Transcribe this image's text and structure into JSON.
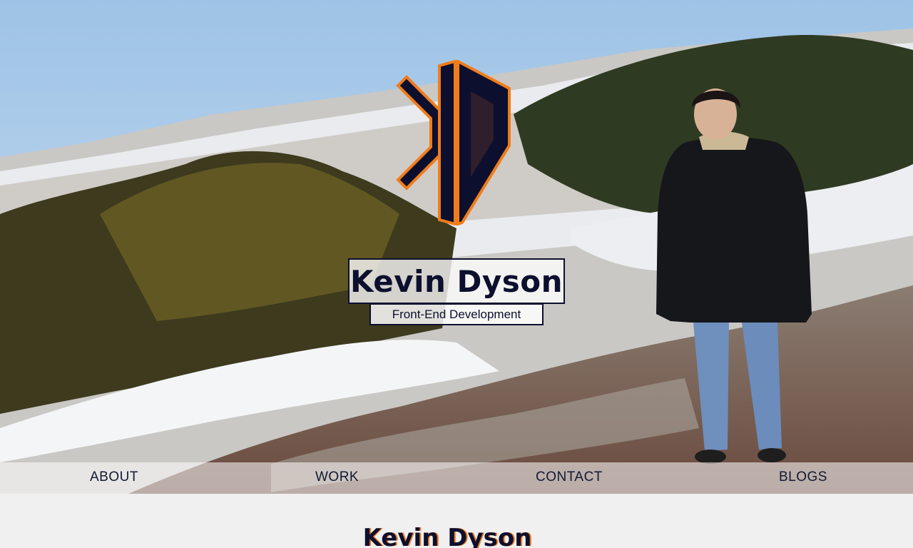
{
  "hero": {
    "name": "Kevin Dyson",
    "subtitle": "Front-End Development",
    "logo_icon": "kd-logo-icon"
  },
  "nav": {
    "items": [
      {
        "label": "ABOUT"
      },
      {
        "label": "WORK"
      },
      {
        "label": "CONTACT"
      },
      {
        "label": "BLOGS"
      }
    ]
  },
  "section": {
    "title": "Kevin Dyson"
  },
  "colors": {
    "navy": "#0d0f2e",
    "orange": "#f07c1a",
    "page_bg": "#f0f0f0"
  }
}
